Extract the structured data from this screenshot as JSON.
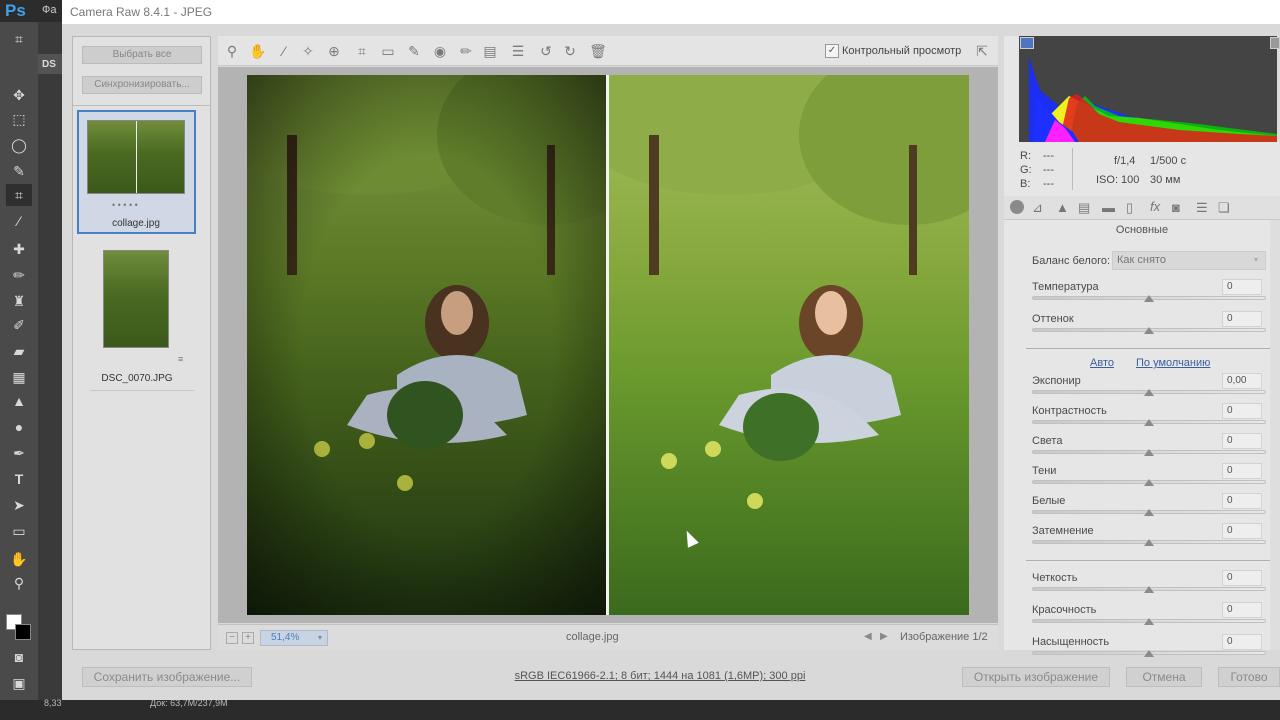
{
  "window": {
    "title": "Camera Raw 8.4.1  -  JPEG"
  },
  "ps": {
    "logo": "Ps",
    "menu_first": "Фа",
    "doc_tab": "DS",
    "status_left": "8,33",
    "status_doc": "Док: 63,7M/237,9M"
  },
  "filmstrip": {
    "select_all": "Выбрать все",
    "sync": "Синхронизировать...",
    "items": [
      {
        "name": "collage.jpg",
        "dots": "• • • • •"
      },
      {
        "name": "DSC_0070.JPG"
      }
    ]
  },
  "toolbar": {
    "icons": [
      "zoom-icon",
      "hand-icon",
      "white-balance-icon",
      "color-sampler-icon",
      "target-adjust-icon",
      "crop-icon",
      "straighten-icon",
      "spot-removal-icon",
      "red-eye-icon",
      "adjustment-brush-icon",
      "graduated-filter-icon",
      "radial-filter-icon",
      "presets-icon",
      "rotate-left-icon",
      "rotate-right-icon",
      "trash-icon"
    ],
    "preview_label": "Контрольный просмотр",
    "preview_checked": "✓"
  },
  "status": {
    "zoom": "51,4%",
    "filename": "collage.jpg",
    "image_counter": "Изображение 1/2"
  },
  "histogram": {
    "r_label": "R:",
    "g_label": "G:",
    "b_label": "B:",
    "r": "---",
    "g": "---",
    "b": "---",
    "aperture": "f/1,4",
    "shutter": "1/500 с",
    "iso": "ISO: 100",
    "focal": "30 мм"
  },
  "panel": {
    "section_title": "Основные",
    "wb_label": "Баланс белого:",
    "wb_value": "Как снято",
    "auto": "Авто",
    "default": "По умолчанию",
    "sliders_wb": [
      {
        "label": "Температура",
        "value": "0",
        "level": 0.5
      },
      {
        "label": "Оттенок",
        "value": "0",
        "level": 0.5
      }
    ],
    "sliders_tone": [
      {
        "label": "Экспонир",
        "value": "0,00",
        "level": 0.5
      },
      {
        "label": "Контрастность",
        "value": "0",
        "level": 0.5
      },
      {
        "label": "Света",
        "value": "0",
        "level": 0.5
      },
      {
        "label": "Тени",
        "value": "0",
        "level": 0.5
      },
      {
        "label": "Белые",
        "value": "0",
        "level": 0.5
      },
      {
        "label": "Затемнение",
        "value": "0",
        "level": 0.5
      }
    ],
    "sliders_presence": [
      {
        "label": "Четкость",
        "value": "0",
        "level": 0.5
      },
      {
        "label": "Красочность",
        "value": "0",
        "level": 0.5
      },
      {
        "label": "Насыщенность",
        "value": "0",
        "level": 0.5
      }
    ]
  },
  "bottom": {
    "save": "Сохранить изображение...",
    "workflow": "sRGB IEC61966-2.1; 8 бит; 1444 на 1081 (1,6МР); 300 ppi",
    "open": "Открыть изображение",
    "cancel": "Отмена",
    "done": "Готово"
  }
}
